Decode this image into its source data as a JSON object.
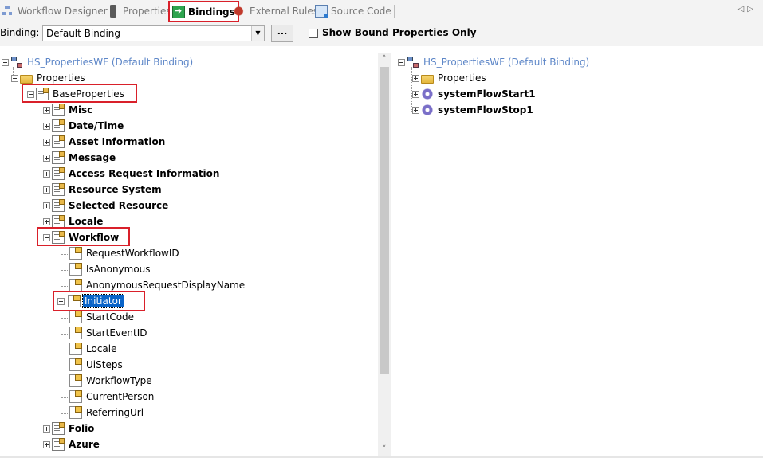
{
  "tabs": [
    {
      "label": "Workflow Designer",
      "icon": "designer-icon",
      "active": false
    },
    {
      "label": "Properties",
      "icon": "properties-icon",
      "active": false
    },
    {
      "label": "Bindings",
      "icon": "bindings-icon",
      "active": true
    },
    {
      "label": "External Rules",
      "icon": "rules-icon",
      "active": false
    },
    {
      "label": "Source Code",
      "icon": "source-code-icon",
      "active": false
    }
  ],
  "nav": {
    "prev": "◁",
    "next": "▷"
  },
  "binding_bar": {
    "label": "Binding:",
    "selected": "Default Binding",
    "dots_label": "...",
    "show_bound_label": "Show Bound Properties Only",
    "show_bound_checked": false
  },
  "left_tree": {
    "root": "HS_PropertiesWF (Default Binding)",
    "properties": "Properties",
    "base_properties": "BaseProperties",
    "groups_before": [
      "Misc",
      "Date/Time",
      "Asset Information",
      "Message",
      "Access Request Information",
      "Resource System",
      "Selected Resource",
      "Locale"
    ],
    "workflow": "Workflow",
    "workflow_children": [
      "RequestWorkflowID",
      "IsAnonymous",
      "AnonymousRequestDisplayName",
      "Initiator",
      "StartCode",
      "StartEventID",
      "Locale",
      "UiSteps",
      "WorkflowType",
      "CurrentPerson",
      "ReferringUrl"
    ],
    "groups_after": [
      "Folio",
      "Azure"
    ]
  },
  "right_tree": {
    "root": "HS_PropertiesWF (Default Binding)",
    "properties": "Properties",
    "items": [
      "systemFlowStart1",
      "systemFlowStop1"
    ]
  },
  "scrollbar": {
    "up": "˄",
    "down": "˅"
  },
  "colors": {
    "highlight": "#d9202a",
    "selection": "#0a64c8",
    "root_text": "#5e87c8"
  }
}
